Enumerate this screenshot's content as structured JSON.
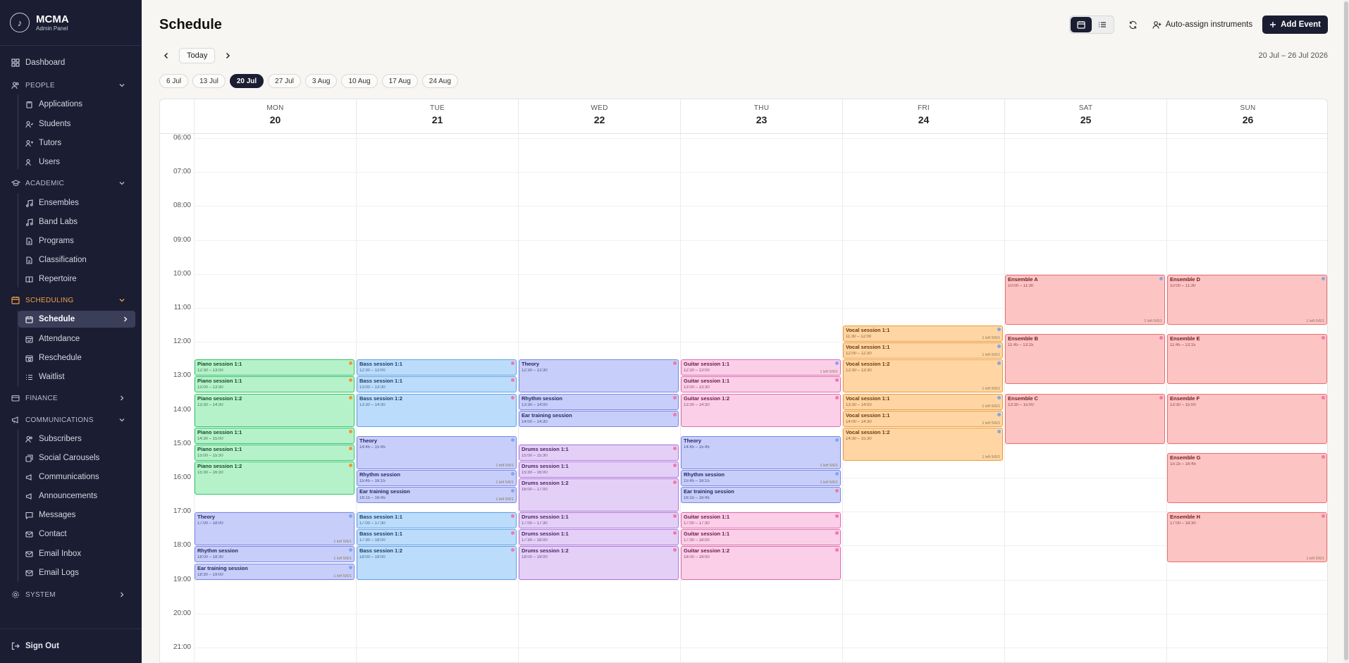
{
  "brand": {
    "name": "MCMA",
    "subtitle": "Admin Panel"
  },
  "sidebar": {
    "dashboard": "Dashboard",
    "people": {
      "label": "PEOPLE",
      "items": [
        "Applications",
        "Students",
        "Tutors",
        "Users"
      ]
    },
    "academic": {
      "label": "ACADEMIC",
      "items": [
        "Ensembles",
        "Band Labs",
        "Programs",
        "Classification",
        "Repertoire"
      ]
    },
    "scheduling": {
      "label": "SCHEDULING",
      "items": [
        "Schedule",
        "Attendance",
        "Reschedule",
        "Waitlist"
      ]
    },
    "finance": {
      "label": "FINANCE"
    },
    "communications": {
      "label": "COMMUNICATIONS",
      "items": [
        "Subscribers",
        "Social Carousels",
        "Communications",
        "Announcements",
        "Messages",
        "Contact",
        "Email Inbox",
        "Email Logs"
      ]
    },
    "system": {
      "label": "SYSTEM"
    },
    "sign_out": "Sign Out",
    "accent_color": "#f0a24a"
  },
  "header": {
    "title": "Schedule",
    "auto_assign": "Auto-assign instruments",
    "add_event": "Add Event",
    "today": "Today",
    "range": "20 Jul – 26 Jul 2026"
  },
  "weeks": [
    "6 Jul",
    "13 Jul",
    "20 Jul",
    "27 Jul",
    "3 Aug",
    "10 Aug",
    "17 Aug",
    "24 Aug"
  ],
  "active_week": "20 Jul",
  "calendar": {
    "days": [
      {
        "dow": "MON",
        "num": "20"
      },
      {
        "dow": "TUE",
        "num": "21"
      },
      {
        "dow": "WED",
        "num": "22"
      },
      {
        "dow": "THU",
        "num": "23"
      },
      {
        "dow": "FRI",
        "num": "24"
      },
      {
        "dow": "SAT",
        "num": "25"
      },
      {
        "dow": "SUN",
        "num": "26"
      }
    ],
    "hours": [
      "06:00",
      "07:00",
      "08:00",
      "09:00",
      "10:00",
      "11:00",
      "12:00",
      "13:00",
      "14:00",
      "15:00",
      "16:00",
      "17:00",
      "18:00",
      "19:00",
      "20:00",
      "21:00"
    ],
    "events": [
      {
        "day": 0,
        "title": "Piano session 1:1",
        "time": "12:30 – 13:00",
        "start": "12:30",
        "end": "13:00",
        "color": "green",
        "dot": "orange"
      },
      {
        "day": 0,
        "title": "Piano session 1:1",
        "time": "13:00 – 13:30",
        "start": "13:00",
        "end": "13:30",
        "color": "green",
        "dot": "orange"
      },
      {
        "day": 0,
        "title": "Piano session 1:2",
        "time": "13:30 – 14:30",
        "start": "13:30",
        "end": "14:30",
        "color": "green",
        "dot": "orange"
      },
      {
        "day": 0,
        "title": "Piano session 1:1",
        "time": "14:30 – 15:00",
        "start": "14:30",
        "end": "15:00",
        "color": "green",
        "dot": "orange"
      },
      {
        "day": 0,
        "title": "Piano session 1:1",
        "time": "15:00 – 15:30",
        "start": "15:00",
        "end": "15:30",
        "color": "green",
        "dot": "orange"
      },
      {
        "day": 0,
        "title": "Piano session 1:2",
        "time": "15:30 – 16:30",
        "start": "15:30",
        "end": "16:30",
        "color": "green",
        "dot": "orange"
      },
      {
        "day": 0,
        "title": "Theory",
        "time": "17:00 – 18:00",
        "start": "17:00",
        "end": "18:00",
        "color": "indigo",
        "dot": "blue",
        "cap": "1 left 5/6/1"
      },
      {
        "day": 0,
        "title": "Rhythm session",
        "time": "18:00 – 18:30",
        "start": "18:00",
        "end": "18:30",
        "color": "indigo",
        "dot": "blue",
        "cap": "1 left 5/6/1"
      },
      {
        "day": 0,
        "title": "Ear training session",
        "time": "18:30 – 19:00",
        "start": "18:30",
        "end": "19:00",
        "color": "indigo",
        "dot": "blue",
        "cap": "1 left 5/6/1"
      },
      {
        "day": 1,
        "title": "Bass session 1:1",
        "time": "12:30 – 13:00",
        "start": "12:30",
        "end": "13:00",
        "color": "blue",
        "dot": "pink"
      },
      {
        "day": 1,
        "title": "Bass session 1:1",
        "time": "13:00 – 13:30",
        "start": "13:00",
        "end": "13:30",
        "color": "blue",
        "dot": "pink"
      },
      {
        "day": 1,
        "title": "Bass session 1:2",
        "time": "13:30 – 14:30",
        "start": "13:30",
        "end": "14:30",
        "color": "blue",
        "dot": "pink"
      },
      {
        "day": 1,
        "title": "Theory",
        "time": "14:45 – 15:45",
        "start": "14:45",
        "end": "15:45",
        "color": "indigo",
        "dot": "blue",
        "cap": "1 left 5/6/1"
      },
      {
        "day": 1,
        "title": "Rhythm session",
        "time": "15:45 – 16:15",
        "start": "15:45",
        "end": "16:15",
        "color": "indigo",
        "dot": "blue",
        "cap": "1 left 5/6/1"
      },
      {
        "day": 1,
        "title": "Ear training session",
        "time": "16:15 – 16:45",
        "start": "16:15",
        "end": "16:45",
        "color": "indigo",
        "dot": "blue",
        "cap": "1 left 5/6/1"
      },
      {
        "day": 1,
        "title": "Bass session 1:1",
        "time": "17:00 – 17:30",
        "start": "17:00",
        "end": "17:30",
        "color": "blue",
        "dot": "pink"
      },
      {
        "day": 1,
        "title": "Bass session 1:1",
        "time": "17:30 – 18:00",
        "start": "17:30",
        "end": "18:00",
        "color": "blue",
        "dot": "pink"
      },
      {
        "day": 1,
        "title": "Bass session 1:2",
        "time": "18:00 – 19:00",
        "start": "18:00",
        "end": "19:00",
        "color": "blue",
        "dot": "pink"
      },
      {
        "day": 2,
        "title": "Theory",
        "time": "12:30 – 13:30",
        "start": "12:30",
        "end": "13:30",
        "color": "indigo",
        "dot": "pink"
      },
      {
        "day": 2,
        "title": "Rhythm session",
        "time": "13:30 – 14:00",
        "start": "13:30",
        "end": "14:00",
        "color": "indigo",
        "dot": "pink"
      },
      {
        "day": 2,
        "title": "Ear training session",
        "time": "14:00 – 14:30",
        "start": "14:00",
        "end": "14:30",
        "color": "indigo",
        "dot": "pink"
      },
      {
        "day": 2,
        "title": "Drums session 1:1",
        "time": "15:00 – 15:30",
        "start": "15:00",
        "end": "15:30",
        "color": "purple",
        "dot": "pink"
      },
      {
        "day": 2,
        "title": "Drums session 1:1",
        "time": "15:30 – 16:00",
        "start": "15:30",
        "end": "16:00",
        "color": "purple",
        "dot": "pink"
      },
      {
        "day": 2,
        "title": "Drums session 1:2",
        "time": "16:00 – 17:00",
        "start": "16:00",
        "end": "17:00",
        "color": "purple",
        "dot": "pink"
      },
      {
        "day": 2,
        "title": "Drums session 1:1",
        "time": "17:00 – 17:30",
        "start": "17:00",
        "end": "17:30",
        "color": "purple",
        "dot": "pink"
      },
      {
        "day": 2,
        "title": "Drums session 1:1",
        "time": "17:30 – 18:00",
        "start": "17:30",
        "end": "18:00",
        "color": "purple",
        "dot": "pink"
      },
      {
        "day": 2,
        "title": "Drums session 1:2",
        "time": "18:00 – 19:00",
        "start": "18:00",
        "end": "19:00",
        "color": "purple",
        "dot": "pink"
      },
      {
        "day": 3,
        "title": "Guitar session 1:1",
        "time": "12:30 – 13:00",
        "start": "12:30",
        "end": "13:00",
        "color": "pink",
        "dot": "blue",
        "cap": "1 left 5/6/1"
      },
      {
        "day": 3,
        "title": "Guitar session 1:1",
        "time": "13:00 – 13:30",
        "start": "13:00",
        "end": "13:30",
        "color": "pink",
        "dot": "pink"
      },
      {
        "day": 3,
        "title": "Guitar session 1:2",
        "time": "13:30 – 14:30",
        "start": "13:30",
        "end": "14:30",
        "color": "pink",
        "dot": "pink"
      },
      {
        "day": 3,
        "title": "Theory",
        "time": "14:45 – 15:45",
        "start": "14:45",
        "end": "15:45",
        "color": "indigo",
        "dot": "blue",
        "cap": "1 left 5/6/1"
      },
      {
        "day": 3,
        "title": "Rhythm session",
        "time": "15:45 – 16:15",
        "start": "15:45",
        "end": "16:15",
        "color": "indigo",
        "dot": "blue",
        "cap": "1 left 5/6/1"
      },
      {
        "day": 3,
        "title": "Ear training session",
        "time": "16:15 – 16:45",
        "start": "16:15",
        "end": "16:45",
        "color": "indigo",
        "dot": "pink"
      },
      {
        "day": 3,
        "title": "Guitar session 1:1",
        "time": "17:00 – 17:30",
        "start": "17:00",
        "end": "17:30",
        "color": "pink",
        "dot": "pink"
      },
      {
        "day": 3,
        "title": "Guitar session 1:1",
        "time": "17:30 – 18:00",
        "start": "17:30",
        "end": "18:00",
        "color": "pink",
        "dot": "pink"
      },
      {
        "day": 3,
        "title": "Guitar session 1:2",
        "time": "18:00 – 19:00",
        "start": "18:00",
        "end": "19:00",
        "color": "pink",
        "dot": "pink"
      },
      {
        "day": 4,
        "title": "Vocal session 1:1",
        "time": "11:30 – 12:00",
        "start": "11:30",
        "end": "12:00",
        "color": "orange",
        "dot": "blue",
        "cap": "1 left 5/6/1"
      },
      {
        "day": 4,
        "title": "Vocal session 1:1",
        "time": "12:00 – 12:30",
        "start": "12:00",
        "end": "12:30",
        "color": "orange",
        "dot": "blue",
        "cap": "1 left 5/6/1"
      },
      {
        "day": 4,
        "title": "Vocal session 1:2",
        "time": "12:30 – 13:30",
        "start": "12:30",
        "end": "13:30",
        "color": "orange",
        "dot": "blue",
        "cap": "1 left 5/6/1"
      },
      {
        "day": 4,
        "title": "Vocal session 1:1",
        "time": "13:30 – 14:00",
        "start": "13:30",
        "end": "14:00",
        "color": "orange",
        "dot": "blue",
        "cap": "1 left 5/6/1"
      },
      {
        "day": 4,
        "title": "Vocal session 1:1",
        "time": "14:00 – 14:30",
        "start": "14:00",
        "end": "14:30",
        "color": "orange",
        "dot": "blue",
        "cap": "1 left 5/6/1"
      },
      {
        "day": 4,
        "title": "Vocal session 1:2",
        "time": "14:30 – 15:30",
        "start": "14:30",
        "end": "15:30",
        "color": "orange",
        "dot": "blue",
        "cap": "1 left 5/6/1"
      },
      {
        "day": 5,
        "title": "Ensemble A",
        "time": "10:00 – 11:30",
        "start": "10:00",
        "end": "11:30",
        "color": "red",
        "dot": "blue",
        "cap": "1 left 5/6/1"
      },
      {
        "day": 5,
        "title": "Ensemble B",
        "time": "11:45 – 13:15",
        "start": "11:45",
        "end": "13:15",
        "color": "red",
        "dot": "pink"
      },
      {
        "day": 5,
        "title": "Ensemble C",
        "time": "13:30 – 15:00",
        "start": "13:30",
        "end": "15:00",
        "color": "red",
        "dot": "pink"
      },
      {
        "day": 6,
        "title": "Ensemble D",
        "time": "10:00 – 11:30",
        "start": "10:00",
        "end": "11:30",
        "color": "red",
        "dot": "blue",
        "cap": "1 left 5/6/1"
      },
      {
        "day": 6,
        "title": "Ensemble E",
        "time": "11:45 – 13:15",
        "start": "11:45",
        "end": "13:15",
        "color": "red",
        "dot": "pink"
      },
      {
        "day": 6,
        "title": "Ensemble F",
        "time": "13:30 – 15:00",
        "start": "13:30",
        "end": "15:00",
        "color": "red",
        "dot": "pink"
      },
      {
        "day": 6,
        "title": "Ensemble G",
        "time": "15:15 – 16:45",
        "start": "15:15",
        "end": "16:45",
        "color": "red",
        "dot": "pink"
      },
      {
        "day": 6,
        "title": "Ensemble H",
        "time": "17:00 – 18:30",
        "start": "17:00",
        "end": "18:30",
        "color": "red",
        "dot": "pink",
        "cap": "1 left 5/6/1"
      }
    ]
  }
}
